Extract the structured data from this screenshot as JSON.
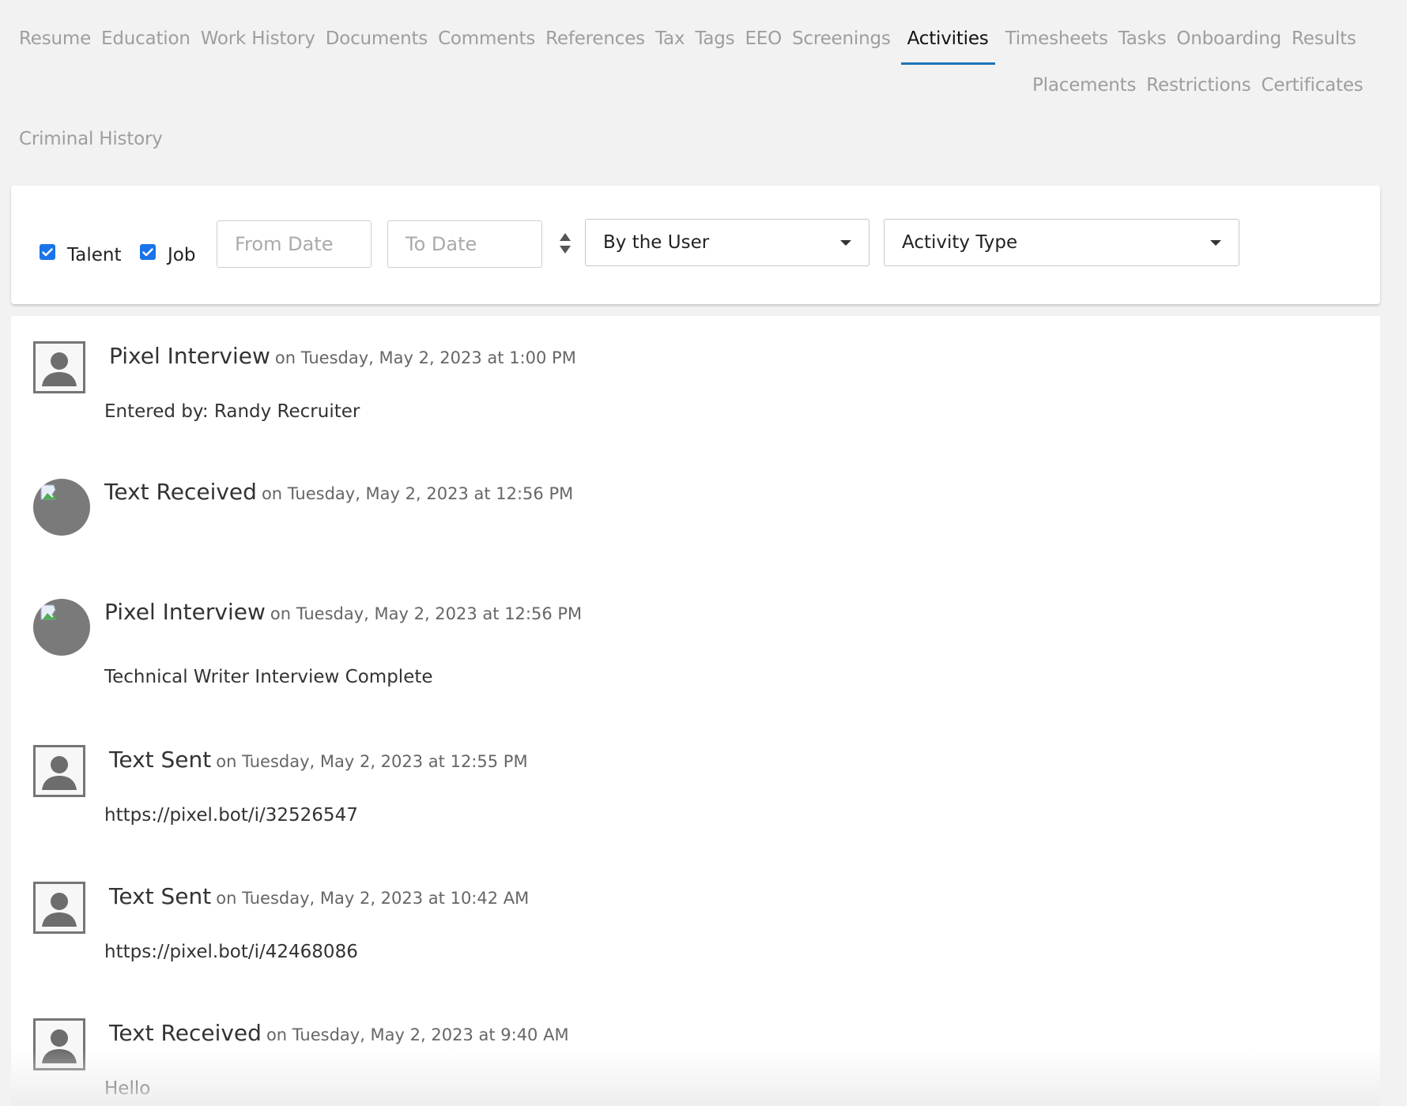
{
  "tabs": {
    "row1": [
      "Resume",
      "Education",
      "Work History",
      "Documents",
      "Comments",
      "References",
      "Tax",
      "Tags",
      "EEO",
      "Screenings",
      "Activities",
      "Timesheets",
      "Tasks",
      "Onboarding",
      "Results"
    ],
    "row2": [
      "Placements",
      "Restrictions",
      "Certificates"
    ],
    "row3": [
      "Criminal History"
    ],
    "active": "Activities"
  },
  "filters": {
    "talent_label": "Talent",
    "talent_checked": true,
    "job_label": "Job",
    "job_checked": true,
    "from_placeholder": "From Date",
    "to_placeholder": "To Date",
    "user_select": "By the User",
    "type_select": "Activity Type"
  },
  "activities": [
    {
      "avatar": "square",
      "title": "Pixel Interview",
      "date": "on Tuesday, May 2, 2023 at 1:00 PM",
      "body": "Entered by: Randy Recruiter"
    },
    {
      "avatar": "round",
      "title": "Text Received",
      "date": "on Tuesday, May 2, 2023 at 12:56 PM",
      "body": ""
    },
    {
      "avatar": "round",
      "title": "Pixel Interview",
      "date": "on Tuesday, May 2, 2023 at 12:56 PM",
      "body": "Technical Writer Interview Complete"
    },
    {
      "avatar": "square",
      "title": "Text Sent",
      "date": "on Tuesday, May 2, 2023 at 12:55 PM",
      "body": "https://pixel.bot/i/32526547"
    },
    {
      "avatar": "square",
      "title": "Text Sent",
      "date": "on Tuesday, May 2, 2023 at 10:42 AM",
      "body": "https://pixel.bot/i/42468086"
    },
    {
      "avatar": "square",
      "title": "Text Received",
      "date": "on Tuesday, May 2, 2023 at 9:40 AM",
      "body": "Hello"
    }
  ],
  "colors": {
    "accent": "#1f73b7",
    "checkbox": "#1a73e8",
    "tab_inactive": "#9e9e9e",
    "page_bg": "#f2f2f2"
  },
  "icons": {
    "checkbox": "checkmark-icon",
    "sort": "sort-up-down-icon",
    "caret": "caret-down-icon",
    "avatar_square": "person-silhouette-icon",
    "avatar_round": "broken-image-icon"
  }
}
